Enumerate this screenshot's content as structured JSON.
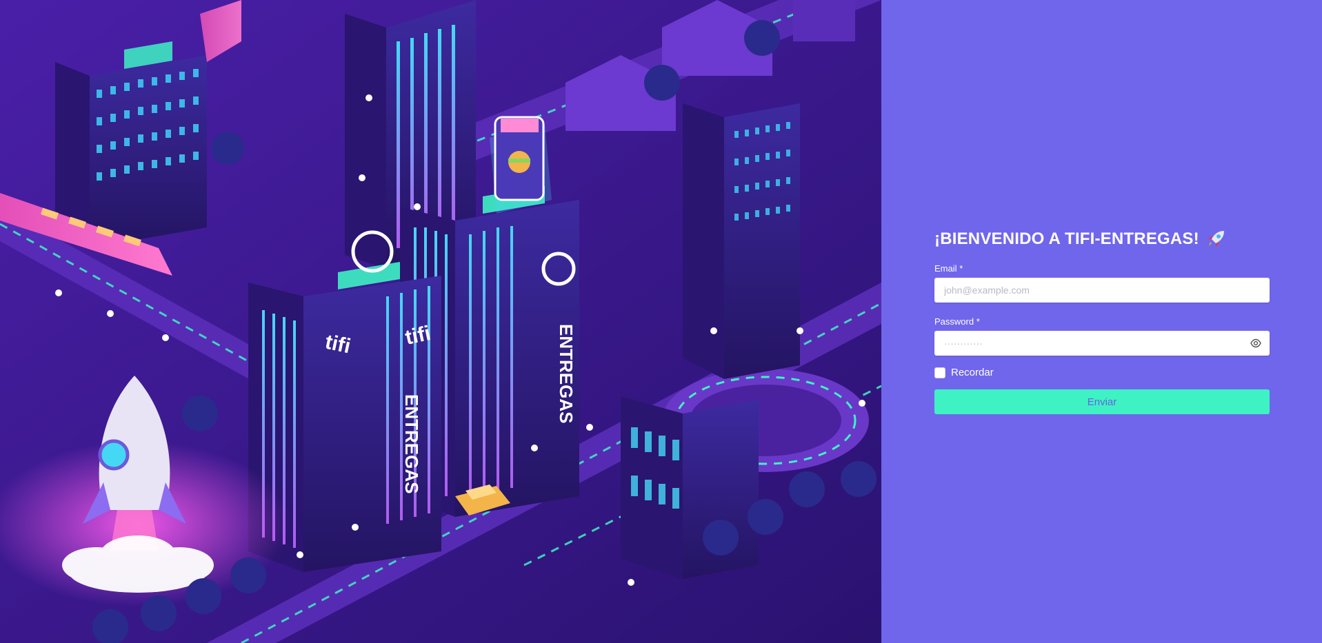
{
  "hero": {
    "illustration": "isometric-neon-city-illustration",
    "tower_texts": [
      "tifi",
      "tifi",
      "ENTREGAS",
      "ENTREGAS"
    ]
  },
  "login": {
    "title": "¡BIENVENIDO A TIFI-ENTREGAS!",
    "title_icon": "rocket-icon",
    "email_label": "Email *",
    "email_placeholder": "john@example.com",
    "email_value": "",
    "password_label": "Password *",
    "password_placeholder": "············",
    "password_value": "",
    "password_toggle_icon": "eye-icon",
    "remember_label": "Recordar",
    "remember_checked": false,
    "submit_label": "Enviar"
  },
  "colors": {
    "panel_bg": "#7066ec",
    "button_bg": "#3ef2c4",
    "button_text": "#6a60e6",
    "hero_bg": "#3a1a8c"
  }
}
